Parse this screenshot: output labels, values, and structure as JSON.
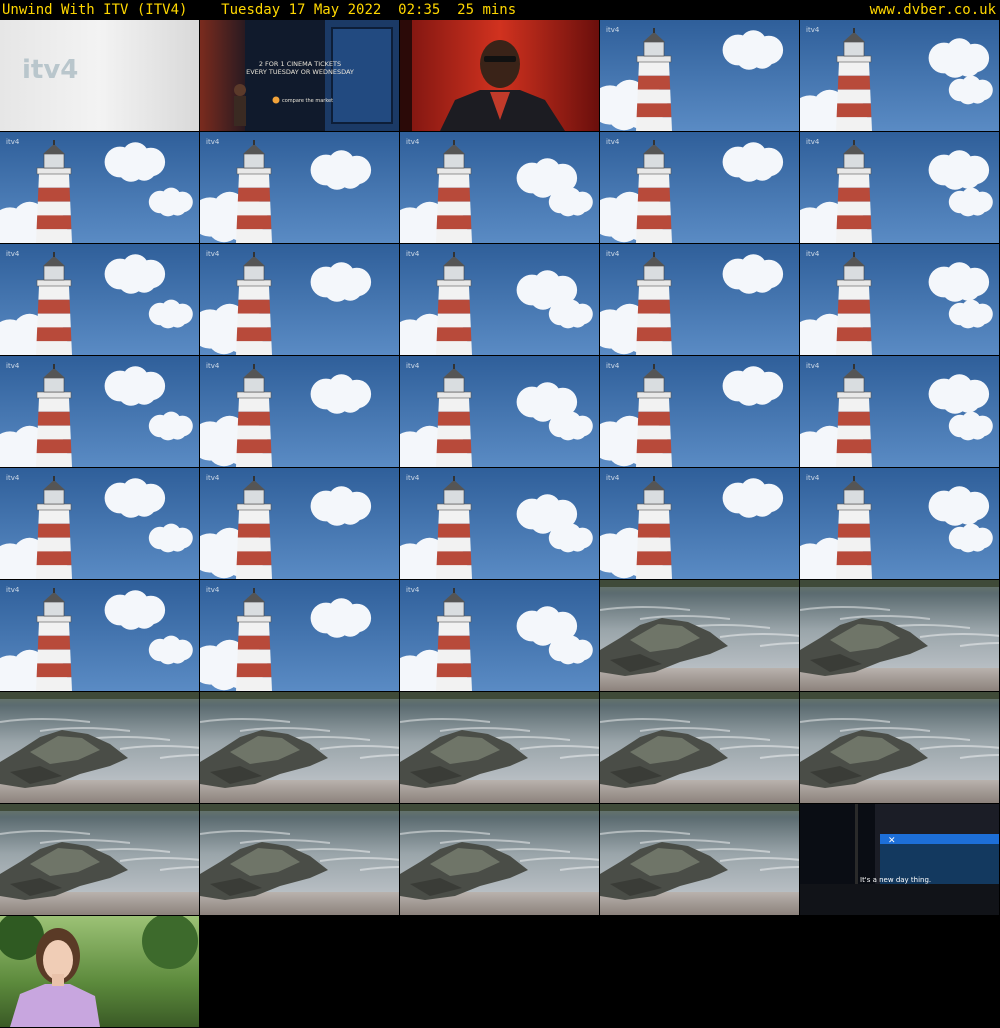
{
  "header": {
    "title": "Unwind With ITV (ITV4)",
    "datetime": "Tuesday 17 May 2022  02:35  25 mins",
    "site": "www.dvber.co.uk"
  },
  "thumbnails": [
    {
      "scene": "itv4-logo",
      "logo_text": "itv4"
    },
    {
      "scene": "cinema-ad",
      "lines": [
        "2 FOR 1 CINEMA TICKETS",
        "EVERY TUESDAY OR WEDNESDAY"
      ],
      "brand": "compare the market"
    },
    {
      "scene": "presenter"
    },
    {
      "scene": "lighthouse"
    },
    {
      "scene": "lighthouse"
    },
    {
      "scene": "lighthouse"
    },
    {
      "scene": "lighthouse"
    },
    {
      "scene": "lighthouse"
    },
    {
      "scene": "lighthouse"
    },
    {
      "scene": "lighthouse"
    },
    {
      "scene": "lighthouse"
    },
    {
      "scene": "lighthouse"
    },
    {
      "scene": "lighthouse"
    },
    {
      "scene": "lighthouse"
    },
    {
      "scene": "lighthouse"
    },
    {
      "scene": "lighthouse"
    },
    {
      "scene": "lighthouse"
    },
    {
      "scene": "lighthouse"
    },
    {
      "scene": "lighthouse"
    },
    {
      "scene": "lighthouse"
    },
    {
      "scene": "lighthouse"
    },
    {
      "scene": "lighthouse"
    },
    {
      "scene": "lighthouse"
    },
    {
      "scene": "lighthouse"
    },
    {
      "scene": "lighthouse"
    },
    {
      "scene": "lighthouse"
    },
    {
      "scene": "lighthouse"
    },
    {
      "scene": "lighthouse"
    },
    {
      "scene": "rock"
    },
    {
      "scene": "rock"
    },
    {
      "scene": "rock"
    },
    {
      "scene": "rock"
    },
    {
      "scene": "rock"
    },
    {
      "scene": "rock"
    },
    {
      "scene": "rock"
    },
    {
      "scene": "rock"
    },
    {
      "scene": "rock"
    },
    {
      "scene": "rock"
    },
    {
      "scene": "rock"
    },
    {
      "scene": "night-street",
      "caption": "It's a new day thing."
    },
    {
      "scene": "woman-park"
    }
  ]
}
